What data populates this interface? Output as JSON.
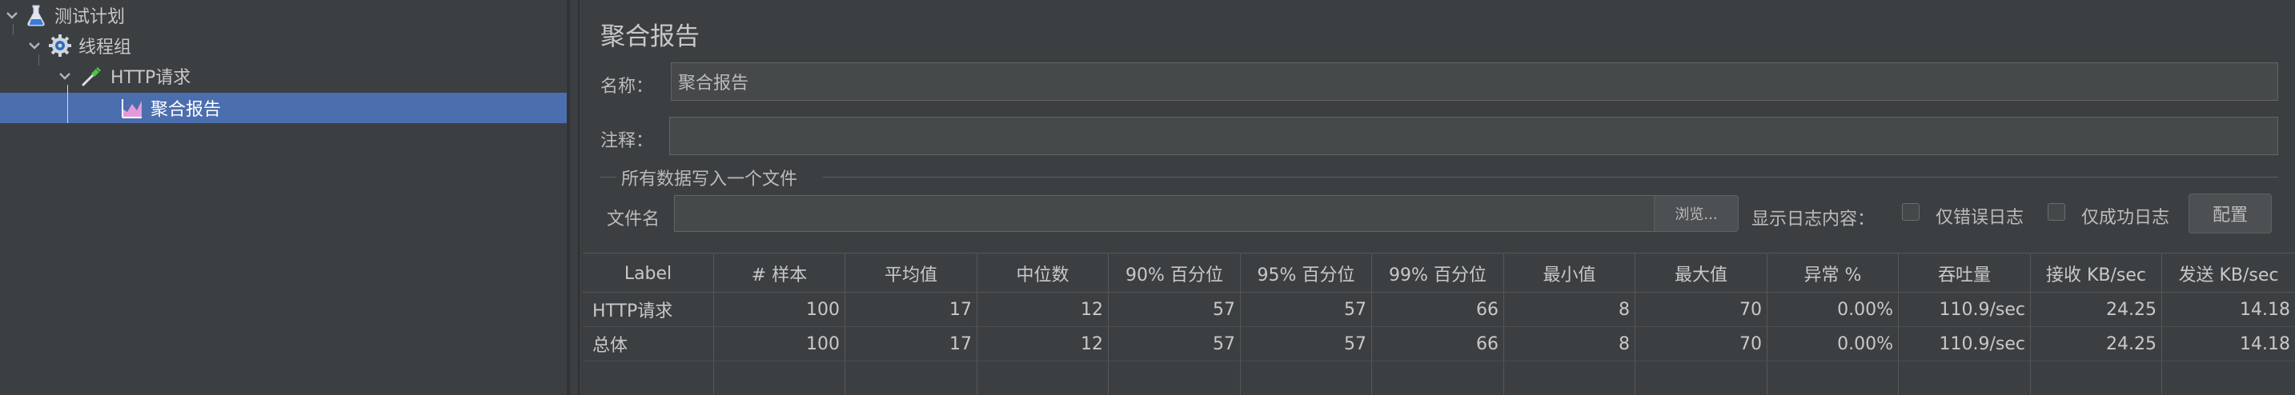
{
  "tree": {
    "items": [
      {
        "label": "测试计划",
        "icon": "flask-icon"
      },
      {
        "label": "线程组",
        "icon": "gear-icon"
      },
      {
        "label": "HTTP请求",
        "icon": "pipette-icon"
      },
      {
        "label": "聚合报告",
        "icon": "graph-icon"
      }
    ]
  },
  "panel": {
    "title": "聚合报告",
    "name_label": "名称：",
    "name_value": "聚合报告",
    "comment_label": "注释：",
    "comment_value": "",
    "fieldset_legend": "所有数据写入一个文件",
    "filename_label": "文件名",
    "filename_value": "",
    "browse_label": "浏览...",
    "log_display_label": "显示日志内容：",
    "errors_only_label": "仅错误日志",
    "success_only_label": "仅成功日志",
    "configure_label": "配置"
  },
  "table": {
    "headers": [
      "Label",
      "# 样本",
      "平均值",
      "中位数",
      "90% 百分位",
      "95% 百分位",
      "99% 百分位",
      "最小值",
      "最大值",
      "异常 %",
      "吞吐量",
      "接收 KB/sec",
      "发送 KB/sec"
    ],
    "rows": [
      [
        "HTTP请求",
        "100",
        "17",
        "12",
        "57",
        "57",
        "66",
        "8",
        "70",
        "0.00%",
        "110.9/sec",
        "24.25",
        "14.18"
      ],
      [
        "总体",
        "100",
        "17",
        "12",
        "57",
        "57",
        "66",
        "8",
        "70",
        "0.00%",
        "110.9/sec",
        "24.25",
        "14.18"
      ]
    ]
  },
  "colors": {
    "background": "#3c3f41",
    "selection": "#4b6eaf",
    "field_bg": "#45494a"
  }
}
